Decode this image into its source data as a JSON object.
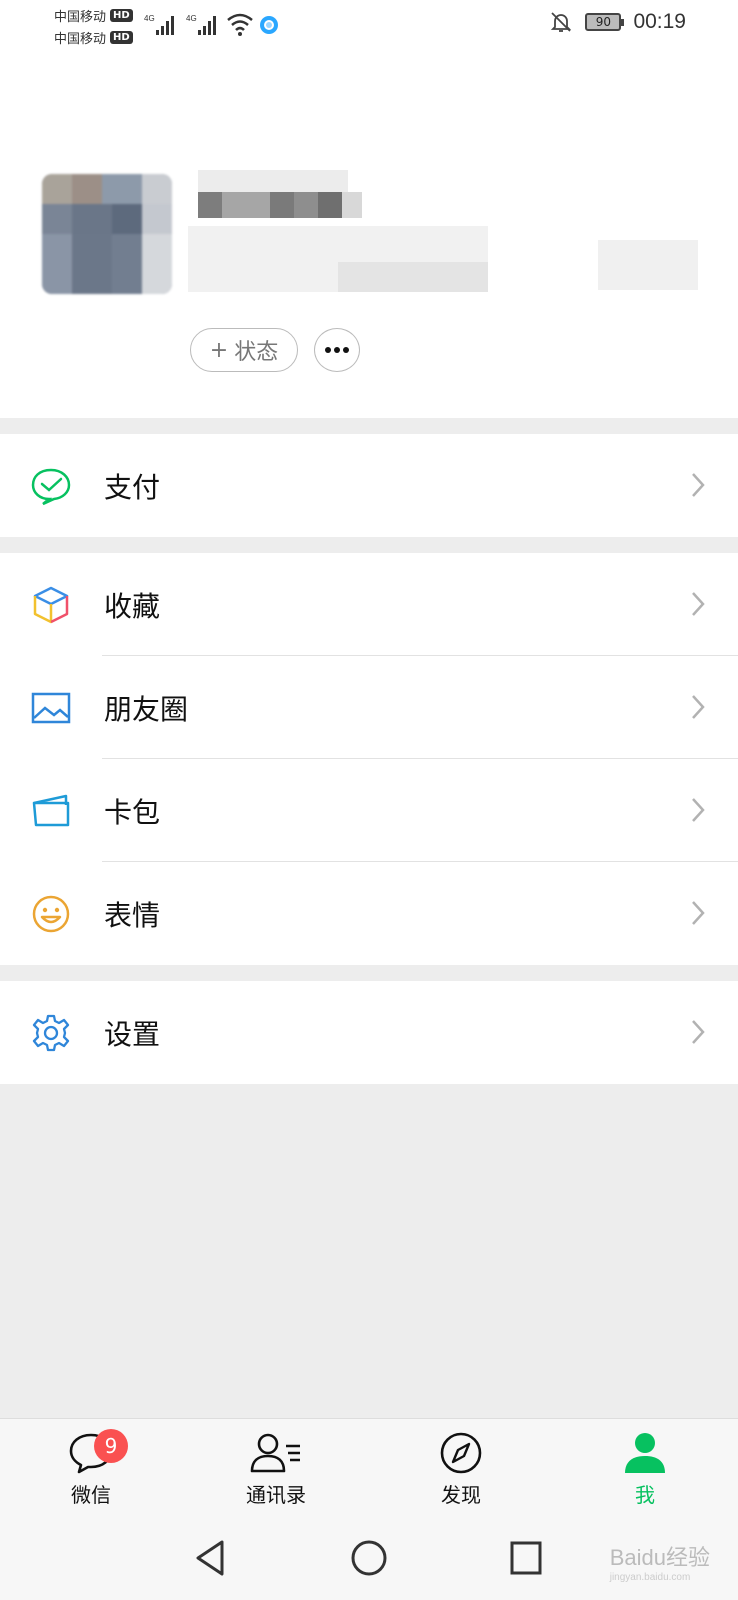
{
  "status_bar": {
    "carrier1": "中国移动",
    "carrier2": "中国移动",
    "hd": "HD",
    "net1": "4G",
    "net2": "4G",
    "battery": "90",
    "time": "00:19"
  },
  "profile": {
    "status_button": "状态",
    "status_plus": "+"
  },
  "menu": {
    "pay": "支付",
    "favorites": "收藏",
    "moments": "朋友圈",
    "cards": "卡包",
    "stickers": "表情",
    "settings": "设置"
  },
  "tabs": {
    "chats": "微信",
    "chats_badge": "9",
    "contacts": "通讯录",
    "discover": "发现",
    "me": "我"
  },
  "watermark": {
    "text": "Baidu经验",
    "url": "jingyan.baidu.com"
  },
  "colors": {
    "accent": "#07c160",
    "badge": "#fa5151",
    "background": "#ededed"
  }
}
